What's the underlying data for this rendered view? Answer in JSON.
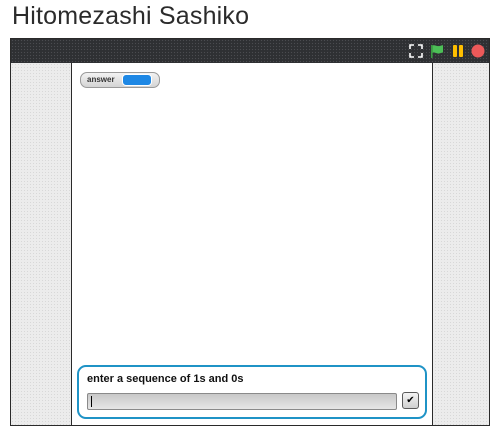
{
  "page": {
    "title": "Hitomezashi Sashiko"
  },
  "toolbar": {
    "icons": [
      "fullscreen-icon",
      "green-flag-icon",
      "pause-icon",
      "stop-icon"
    ],
    "colors": {
      "background": "#2e3033",
      "flag": "#4cbf56",
      "pause": "#ffbf00",
      "stop": "#ec5959"
    }
  },
  "stage": {
    "monitor": {
      "label": "answer",
      "value": ""
    },
    "ask": {
      "prompt": "enter a sequence of 1s and 0s",
      "input_value": "",
      "submit_label": "✔",
      "accent": "#1f93c6"
    }
  }
}
